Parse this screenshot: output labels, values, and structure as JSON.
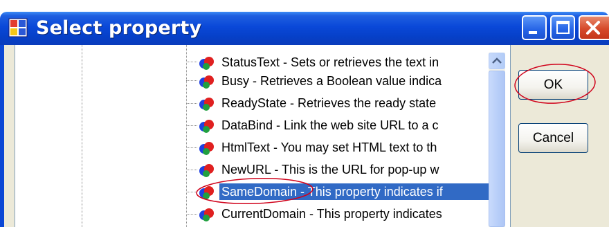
{
  "window": {
    "title": "Select property",
    "icon": "app-window-icon",
    "controls": [
      "minimize-icon",
      "maximize-icon",
      "close-icon"
    ]
  },
  "tree": {
    "items": [
      {
        "label": "StatusText - Sets or retrieves the text in",
        "icon": "property-icon"
      },
      {
        "label": "Busy - Retrieves a Boolean value indica",
        "icon": "property-icon"
      },
      {
        "label": "ReadyState - Retrieves the ready state",
        "icon": "property-icon"
      },
      {
        "label": "DataBind - Link the web site URL to a c",
        "icon": "property-icon"
      },
      {
        "label": "HtmlText - You may set HTML text to th",
        "icon": "property-icon"
      },
      {
        "label": "NewURL - This is the URL for pop-up w",
        "icon": "property-icon"
      },
      {
        "label": "SameDomain - This property indicates if",
        "icon": "property-icon",
        "selected": true
      },
      {
        "label": "CurrentDomain - This property indicates",
        "icon": "property-icon"
      }
    ]
  },
  "buttons": {
    "ok_label": "OK",
    "cancel_label": "Cancel"
  },
  "colors": {
    "title_bar": "#0a48d8",
    "selection": "#316ac5",
    "annotation": "#d0021b",
    "dialog_face": "#ece9d8"
  }
}
